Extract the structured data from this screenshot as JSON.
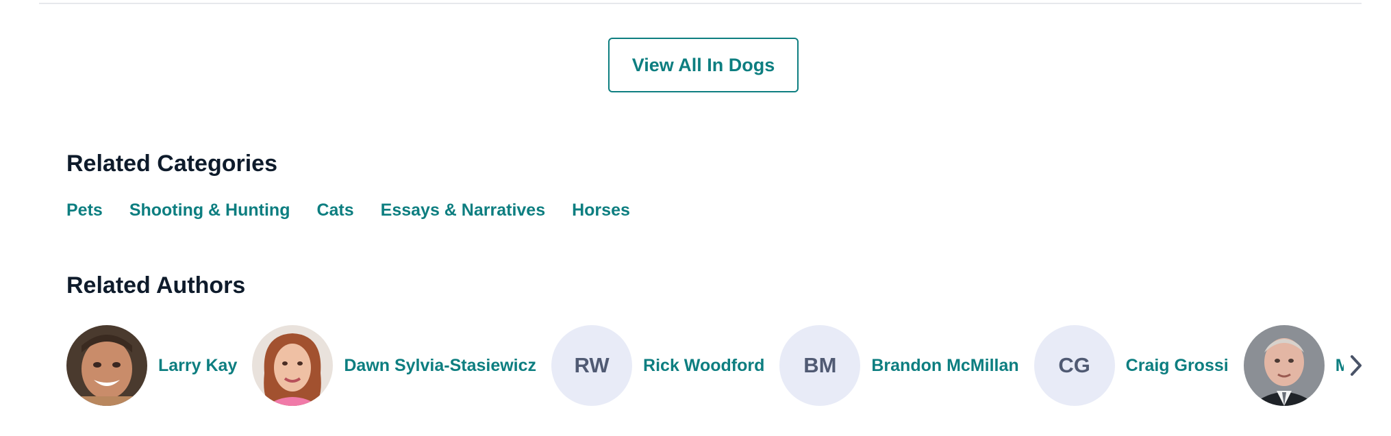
{
  "view_all_button": {
    "label": "View All In Dogs"
  },
  "related_categories": {
    "heading": "Related Categories",
    "items": [
      "Pets",
      "Shooting & Hunting",
      "Cats",
      "Essays & Narratives",
      "Horses"
    ]
  },
  "related_authors": {
    "heading": "Related Authors",
    "items": [
      {
        "name": "Larry Kay",
        "avatar": "photo"
      },
      {
        "name": "Dawn Sylvia-Stasiewicz",
        "avatar": "photo"
      },
      {
        "name": "Rick Woodford",
        "initials": "RW"
      },
      {
        "name": "Brandon McMillan",
        "initials": "BM"
      },
      {
        "name": "Craig Grossi",
        "initials": "CG"
      },
      {
        "name": "Michae",
        "avatar": "photo"
      }
    ]
  },
  "icons": {
    "next": "chevron-right-icon"
  },
  "colors": {
    "link": "#0d7e80",
    "heading": "#0e1b2b",
    "initials_bg": "#e8ebf7",
    "initials_text": "#505a73"
  }
}
